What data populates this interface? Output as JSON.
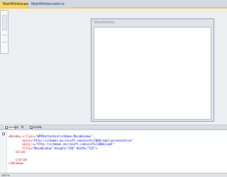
{
  "tabs": [
    {
      "label": "MainWindow.xaml",
      "active": true
    },
    {
      "label": "MainWindow.xaml.cs",
      "active": false
    }
  ],
  "tab_close_glyph": "×",
  "designer": {
    "window_title": "MainWindow"
  },
  "split_tabs": {
    "design_label": "Design",
    "swap_glyph": "⇅",
    "xaml_label": "XAML"
  },
  "editor": {
    "lines": [
      {
        "tag": "<Window",
        "attr": " x:Class",
        "eq": "=",
        "val": "\"WPFButtonControlDemo.MainWindow\""
      },
      {
        "tag": "",
        "attr": "        xmlns",
        "eq": "=",
        "val": "\"http://schemas.microsoft.com/winfx/2006/xaml/presentation\""
      },
      {
        "tag": "",
        "attr": "        xmlns:x",
        "eq": "=",
        "val": "\"http://schemas.microsoft.com/winfx/2006/xaml\""
      },
      {
        "tag": "",
        "attr": "        Title",
        "eq": "=",
        "val": "\"MainWindow\" Height=\"350\" Width=\"525\">"
      },
      {
        "tag": "    <Grid>",
        "attr": "",
        "eq": "",
        "val": ""
      },
      {
        "tag": "",
        "attr": "",
        "eq": "",
        "val": ""
      },
      {
        "tag": "    </Grid>",
        "attr": "",
        "eq": "",
        "val": ""
      },
      {
        "tag": "</Window>",
        "attr": "",
        "eq": "",
        "val": ""
      }
    ],
    "fold_glyph": "-"
  },
  "status": {
    "zoom": "100 %"
  },
  "colors": {
    "active_tab": "#f7d866",
    "tab_underline": "#f1c64a",
    "xml_tag": "#a31515",
    "xml_attr": "#ff0000",
    "xml_value": "#0000ff"
  }
}
